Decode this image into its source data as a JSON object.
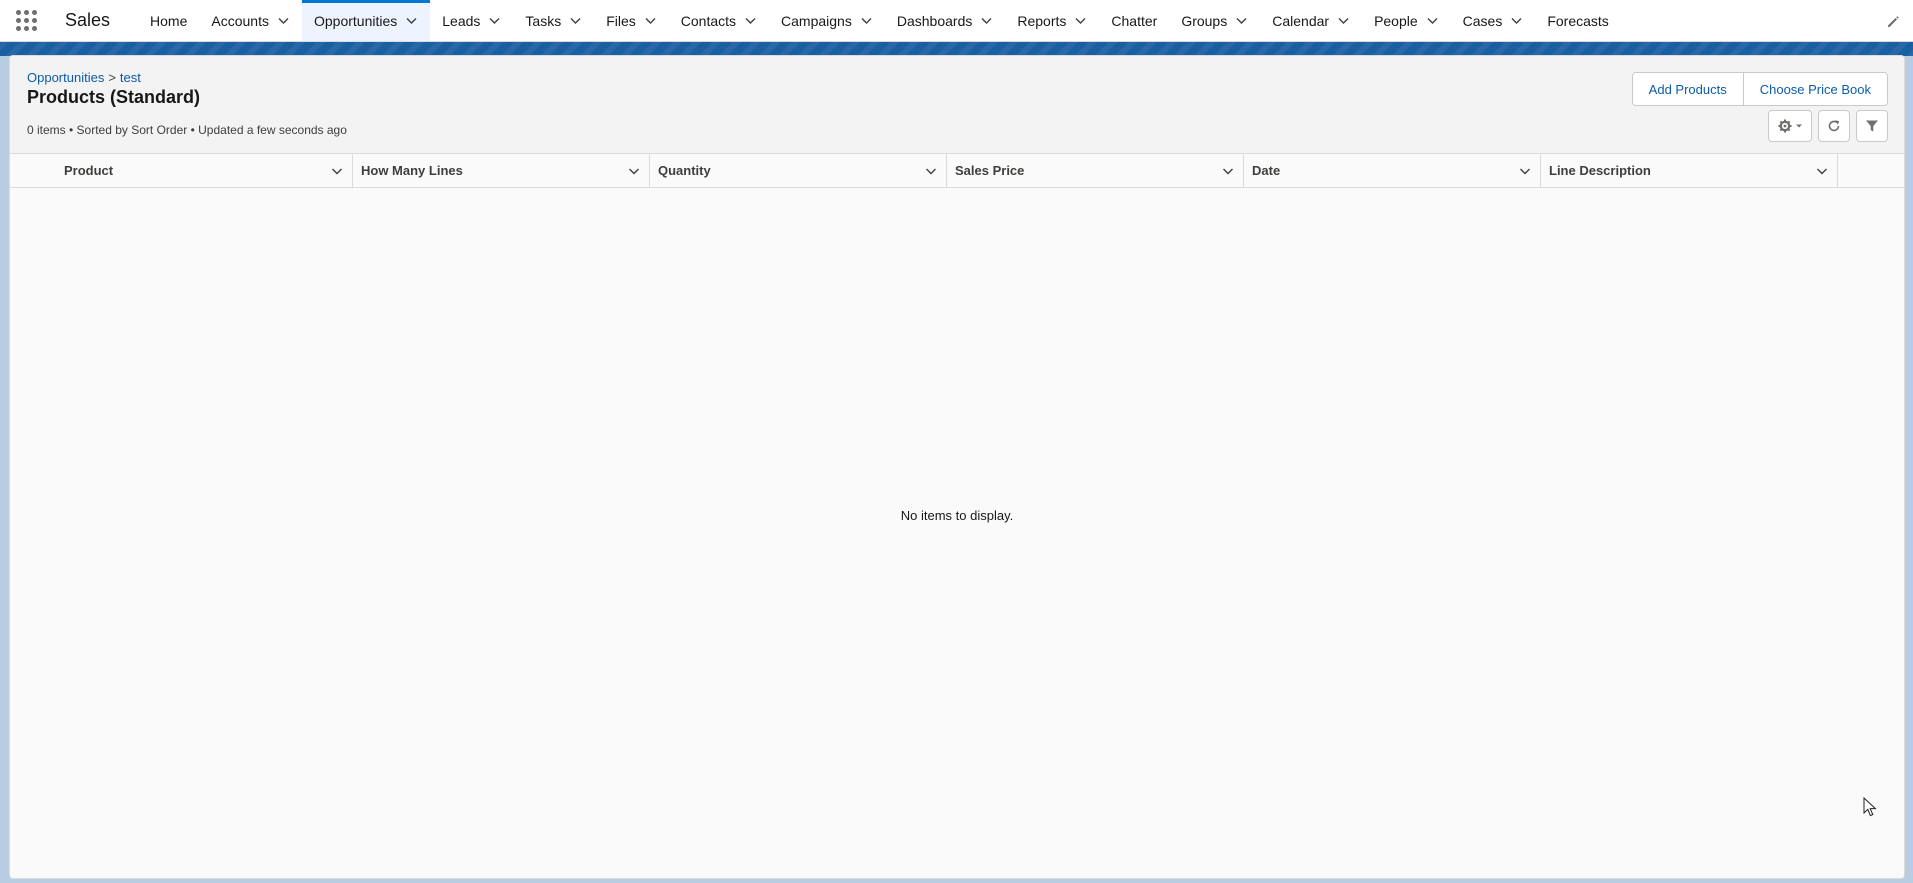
{
  "app": {
    "name": "Sales"
  },
  "nav": {
    "items": [
      {
        "label": "Home",
        "chevron": false,
        "active": false
      },
      {
        "label": "Accounts",
        "chevron": true,
        "active": false
      },
      {
        "label": "Opportunities",
        "chevron": true,
        "active": true
      },
      {
        "label": "Leads",
        "chevron": true,
        "active": false
      },
      {
        "label": "Tasks",
        "chevron": true,
        "active": false
      },
      {
        "label": "Files",
        "chevron": true,
        "active": false
      },
      {
        "label": "Contacts",
        "chevron": true,
        "active": false
      },
      {
        "label": "Campaigns",
        "chevron": true,
        "active": false
      },
      {
        "label": "Dashboards",
        "chevron": true,
        "active": false
      },
      {
        "label": "Reports",
        "chevron": true,
        "active": false
      },
      {
        "label": "Chatter",
        "chevron": false,
        "active": false
      },
      {
        "label": "Groups",
        "chevron": true,
        "active": false
      },
      {
        "label": "Calendar",
        "chevron": true,
        "active": false
      },
      {
        "label": "People",
        "chevron": true,
        "active": false
      },
      {
        "label": "Cases",
        "chevron": true,
        "active": false
      },
      {
        "label": "Forecasts",
        "chevron": false,
        "active": false
      }
    ]
  },
  "breadcrumb": {
    "parent": "Opportunities",
    "separator": ">",
    "record": "test"
  },
  "page": {
    "title": "Products (Standard)",
    "meta": "0 items • Sorted by Sort Order • Updated a few seconds ago"
  },
  "actions": {
    "add_products": "Add Products",
    "choose_price_book": "Choose Price Book"
  },
  "table": {
    "columns": [
      "Product",
      "How Many Lines",
      "Quantity",
      "Sales Price",
      "Date",
      "Line Description"
    ],
    "empty_message": "No items to display."
  },
  "colors": {
    "accent": "#0176d3",
    "link": "#0b5cab",
    "band": "#1b5fa3"
  }
}
